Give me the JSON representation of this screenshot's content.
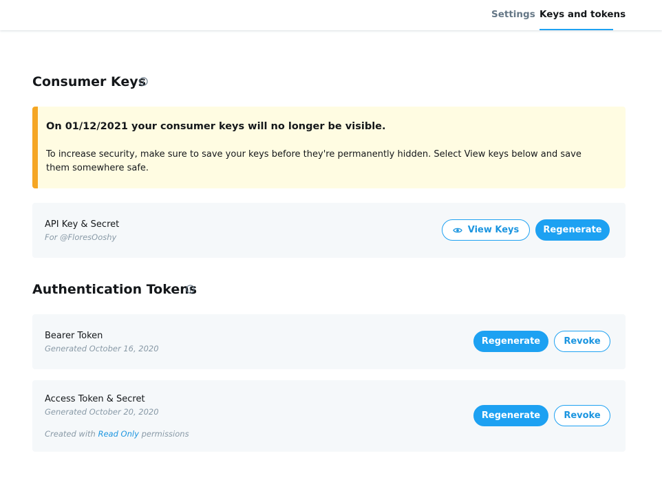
{
  "nav": {
    "tabs": [
      {
        "label": "Settings",
        "active": false
      },
      {
        "label": "Keys and tokens",
        "active": true
      }
    ]
  },
  "consumer_keys": {
    "title": "Consumer Keys",
    "warning": {
      "title": "On 01/12/2021 your consumer keys will no longer be visible.",
      "body": "To increase security, make sure to save your keys before they're permanently hidden. Select View keys below and save them somewhere safe."
    },
    "api_key": {
      "title": "API Key & Secret",
      "subtitle": "For @FloresOoshy",
      "view_label": "View Keys",
      "regenerate_label": "Regenerate"
    }
  },
  "auth_tokens": {
    "title": "Authentication Tokens",
    "bearer": {
      "title": "Bearer Token",
      "subtitle": "Generated October 16, 2020",
      "regenerate_label": "Regenerate",
      "revoke_label": "Revoke"
    },
    "access": {
      "title": "Access Token & Secret",
      "subtitle": "Generated October 20, 2020",
      "permissions_prefix": "Created with",
      "permissions_link": "Read Only",
      "permissions_suffix": "permissions",
      "regenerate_label": "Regenerate",
      "revoke_label": "Revoke"
    }
  },
  "colors": {
    "accent": "#1da1f2",
    "warning_bar": "#f5a623",
    "warning_bg": "#fffce2",
    "card_bg": "#f5f8fa"
  }
}
